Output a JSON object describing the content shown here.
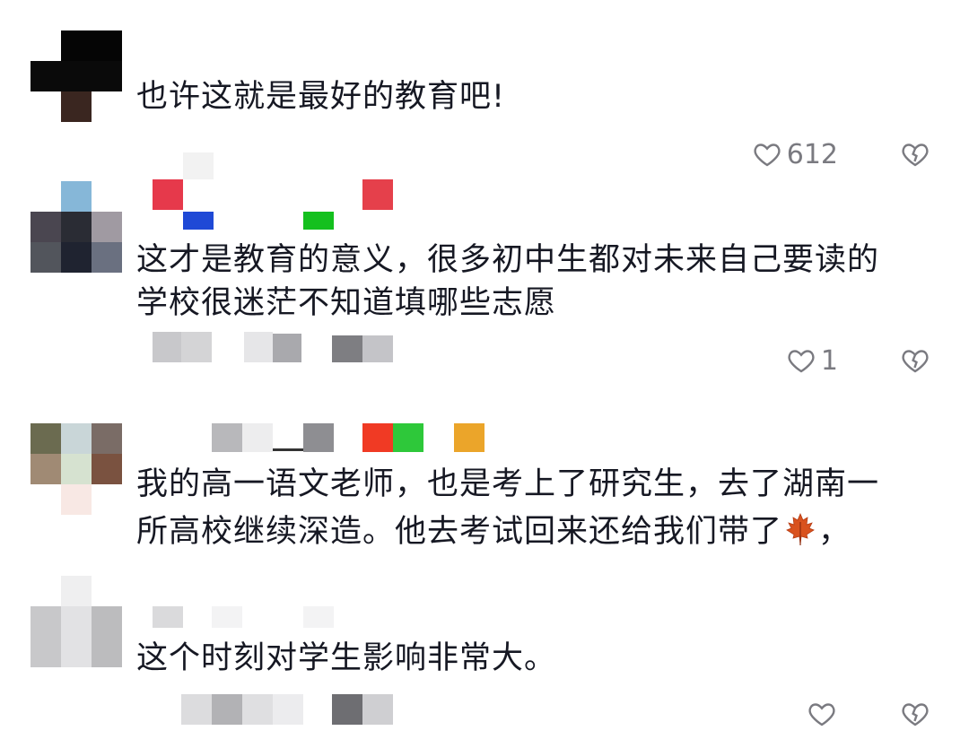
{
  "comments": [
    {
      "text": "也许这就是最好的教育吧!",
      "likes": "612"
    },
    {
      "text_line1": "这才是教育的意义，很多初中生都对未来自己要读的",
      "text_line2": "学校很迷茫不知道填哪些志愿",
      "likes": "1"
    },
    {
      "text_line1": "我的高一语文老师，也是考上了研究生，去了湖南一",
      "text_line2_prefix": "所高校继续深造。他去考试回来还给我们带了",
      "emoji": "maple-leaf",
      "text_line2_suffix": "，"
    },
    {
      "text": "这个时刻对学生影响非常大。",
      "likes": ""
    }
  ],
  "icons": {
    "like": "heart-outline-icon",
    "dislike": "broken-heart-icon"
  },
  "colors": {
    "text": "#161823",
    "meta": "#7a7a80"
  }
}
